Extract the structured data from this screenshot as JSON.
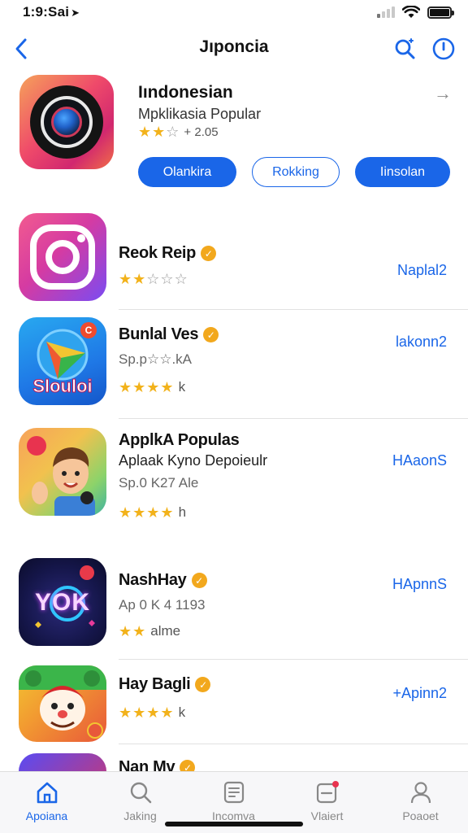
{
  "status": {
    "time": "1:9:Sai",
    "location_glyph": "➤"
  },
  "nav": {
    "title": "Jıponcia"
  },
  "featured": {
    "title": "Iındonesian",
    "subtitle": "Mpklikasia Popular",
    "stars": [
      true,
      true,
      false
    ],
    "rating_text": "+ 2.05",
    "arrow": "→",
    "buttons": {
      "primary_left": "Olankira",
      "outline": "Rokking",
      "primary_right": "Iinsolan"
    }
  },
  "apps": [
    {
      "name": "Reok Reip",
      "subtitle": "",
      "meta": "",
      "stars": [
        true,
        true,
        false,
        false,
        false
      ],
      "rating_suffix": "",
      "action": "Naplal2"
    },
    {
      "name": "Bunlal Ves",
      "subtitle": "",
      "meta": "Sp.p☆☆.kA",
      "stars": [
        true,
        true,
        true,
        true
      ],
      "rating_suffix": "k",
      "action": "lakonn2",
      "icon_text": "Slouloi"
    },
    {
      "name": "ApplkA Populas",
      "subtitle": "Aplaak Kyno Depoieulr",
      "meta": "Sp.0 K27 Ale",
      "stars": [
        true,
        true,
        true,
        true
      ],
      "rating_suffix": "h",
      "action": "HAaonS"
    },
    {
      "name": "NashHay",
      "subtitle": "",
      "meta": "Ap 0 K 4 1193",
      "stars": [
        true,
        true
      ],
      "rating_suffix": "alme",
      "action": "HApnnS",
      "icon_text": "YOK"
    },
    {
      "name": "Hay Bagli",
      "subtitle": "",
      "meta": "",
      "stars": [
        true,
        true,
        true,
        true
      ],
      "rating_suffix": "k",
      "action": "+Apinn2"
    },
    {
      "name": "Nan Mv",
      "subtitle": "",
      "meta": "",
      "stars": [],
      "rating_suffix": "",
      "action": ""
    }
  ],
  "tabs": [
    {
      "label": "Apoiana",
      "icon": "home-icon",
      "active": true
    },
    {
      "label": "Jaking",
      "icon": "search-icon",
      "active": false
    },
    {
      "label": "Incomva",
      "icon": "document-icon",
      "active": false
    },
    {
      "label": "Vlaiert",
      "icon": "notification-icon",
      "active": false
    },
    {
      "label": "Poaoet",
      "icon": "profile-icon",
      "active": false
    }
  ],
  "colors": {
    "accent": "#1a66e8",
    "star": "#f2b21b",
    "verified": "#f2a81d"
  }
}
